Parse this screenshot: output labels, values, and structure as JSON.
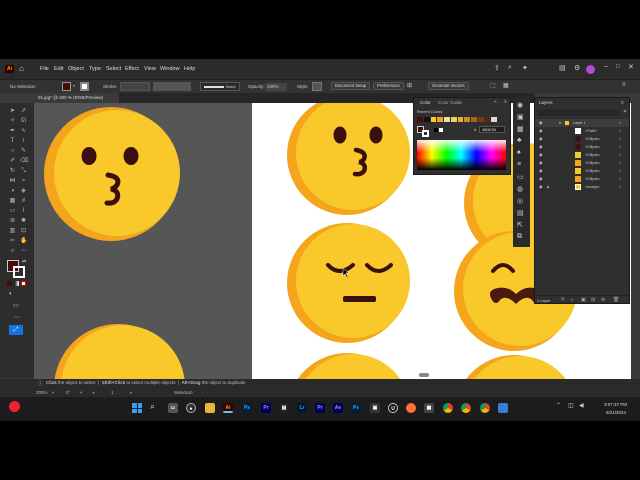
{
  "app": {
    "logo": "Ai",
    "menus": [
      "File",
      "Edit",
      "Object",
      "Type",
      "Select",
      "Effect",
      "View",
      "Window",
      "Help"
    ]
  },
  "control_bar": {
    "selection": "No Selection",
    "stroke_label": "Stroke:",
    "brush": "Basic",
    "opacity_label": "Opacity:",
    "opacity_value": "100%",
    "style_label": "Style:",
    "document_setup": "Document Setup",
    "preferences": "Preferences",
    "generate_vectors": "Generate Vectors"
  },
  "document": {
    "tab_title": "01.jpg* @ 200 % (RGB/Preview)"
  },
  "status_bar": {
    "zoom": "200%",
    "rotation": "0°",
    "page": "1",
    "tool": "Selection",
    "hint_click": "Click",
    "hint_click_text": "the object to select",
    "hint_shift": "Shift+Click",
    "hint_shift_text": "to select multiple objects",
    "hint_alt": "Alt+Drag",
    "hint_alt_text": "the object to duplicate"
  },
  "color_panel": {
    "tab_color": "Color",
    "tab_guide": "Color Guide",
    "recent_label": "Recent Colors",
    "hex_value": "480C04"
  },
  "layers_panel": {
    "title": "Layers",
    "layer_name": "Layer 1",
    "items": [
      "<Path>",
      "<Ellipse>",
      "<Ellipse>",
      "<Ellipse>",
      "<Ellipse>",
      "<Ellipse>",
      "<Ellipse>",
      "<Image>"
    ],
    "footer": "1 Layer"
  },
  "taskbar": {
    "time": "3:07:37 PM",
    "date": "9/21/2024",
    "apps": [
      "Ps",
      "Pr",
      "Lr",
      "Pr",
      "Ae",
      "Ps"
    ]
  },
  "colors": {
    "face": "#F9C82A",
    "face_shadow": "#F4A51C",
    "feature": "#3C0F0F",
    "mustache": "#4A1A10",
    "fill_swatch": "#480C04"
  }
}
